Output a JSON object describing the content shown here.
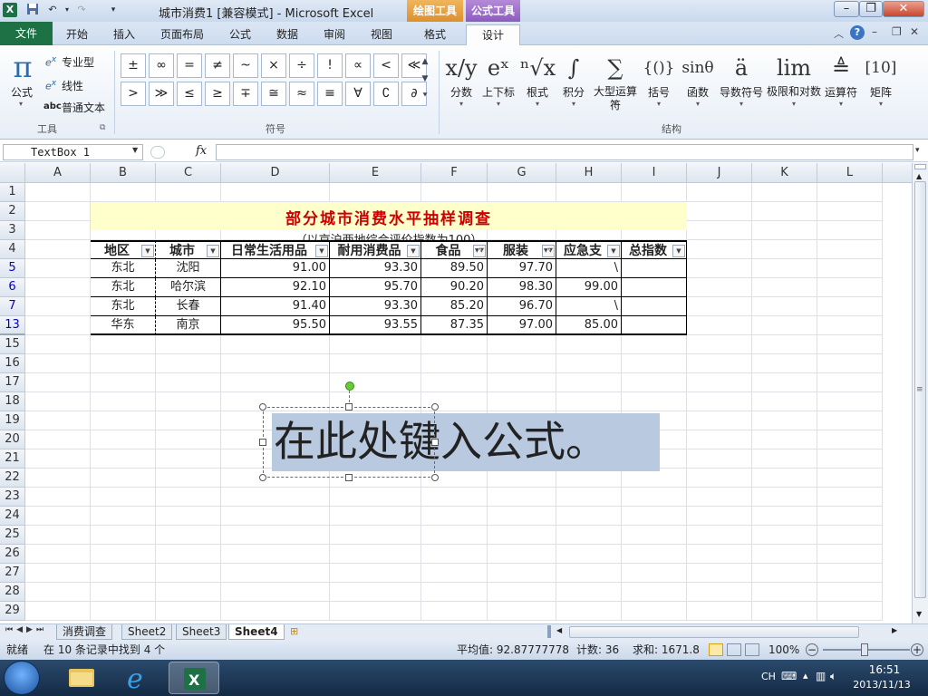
{
  "window": {
    "title": "城市消费1  [兼容模式] - Microsoft Excel",
    "context_tabs": [
      "绘图工具",
      "公式工具"
    ],
    "tabs": [
      "文件",
      "开始",
      "插入",
      "页面布局",
      "公式",
      "数据",
      "审阅",
      "视图",
      "格式",
      "设计"
    ],
    "active_tab": "设计"
  },
  "ribbon": {
    "tools_group": {
      "label": "工具",
      "equation_label": "公式",
      "professional": "专业型",
      "linear": "线性",
      "plain_text": "普通文本",
      "pi_glyph": "π",
      "abc_glyph": "abc"
    },
    "symbols_group": {
      "label": "符号",
      "symbols": [
        "±",
        "∞",
        "=",
        "≠",
        "~",
        "×",
        "÷",
        "!",
        "∝",
        "<",
        "≪",
        ">",
        "≫",
        "≤",
        "≥",
        "∓",
        "≅",
        "≈",
        "≡",
        "∀",
        "∁",
        "∂"
      ]
    },
    "structures_group": {
      "label": "结构",
      "items": [
        {
          "label": "分数",
          "glyph": "x/y"
        },
        {
          "label": "上下标",
          "glyph": "eˣ"
        },
        {
          "label": "根式",
          "glyph": "ⁿ√x"
        },
        {
          "label": "积分",
          "glyph": "∫"
        },
        {
          "label": "大型运算符",
          "glyph": "∑"
        },
        {
          "label": "括号",
          "glyph": "{()}"
        },
        {
          "label": "函数",
          "glyph": "sinθ"
        },
        {
          "label": "导数符号",
          "glyph": "ä"
        },
        {
          "label": "极限和对数",
          "glyph": "lim"
        },
        {
          "label": "运算符",
          "glyph": "≜"
        },
        {
          "label": "矩阵",
          "glyph": "[10]"
        }
      ]
    }
  },
  "formula_bar": {
    "name_box": "TextBox 1",
    "fx": "fx",
    "value": ""
  },
  "sheet": {
    "columns": [
      "A",
      "B",
      "C",
      "D",
      "E",
      "F",
      "G",
      "H",
      "I",
      "J",
      "K",
      "L"
    ],
    "rows": [
      "1",
      "2",
      "3",
      "4",
      "5",
      "6",
      "7",
      "13",
      "15",
      "16",
      "17",
      "18",
      "19",
      "20",
      "21",
      "22",
      "23",
      "24",
      "25",
      "26",
      "27",
      "28",
      "29"
    ],
    "title": "部分城市消费水平抽样调查",
    "subtitle": "（以京沪两地综合评价指数为100）",
    "headers": [
      "地区",
      "城市",
      "日常生活用品",
      "耐用消费品",
      "食品",
      "服装",
      "应急支出",
      "总指数"
    ],
    "header_display": [
      "地区",
      "城市",
      "日常生活用品",
      "耐用消费品",
      "食品",
      "服装",
      "应急支",
      "总指数"
    ],
    "data": [
      [
        "东北",
        "沈阳",
        "91.00",
        "93.30",
        "89.50",
        "97.70",
        "\\",
        ""
      ],
      [
        "东北",
        "哈尔滨",
        "92.10",
        "95.70",
        "90.20",
        "98.30",
        "99.00",
        ""
      ],
      [
        "东北",
        "长春",
        "91.40",
        "93.30",
        "85.20",
        "96.70",
        "\\",
        ""
      ],
      [
        "华东",
        "南京",
        "95.50",
        "93.55",
        "87.35",
        "97.00",
        "85.00",
        ""
      ]
    ]
  },
  "textbox": {
    "text": "在此处键入公式。"
  },
  "sheet_tabs": [
    "消费调查",
    "Sheet2",
    "Sheet3",
    "Sheet4"
  ],
  "active_sheet": "Sheet4",
  "status": {
    "ready": "就绪",
    "filter_info": "在 10 条记录中找到 4 个",
    "average": "平均值: 92.87777778",
    "count": "计数: 36",
    "sum": "求和: 1671.8",
    "zoom": "100%"
  },
  "taskbar": {
    "lang": "CH",
    "time": "16:51",
    "date": "2013/11/13"
  },
  "colors": {
    "file_tab": "#1e7145",
    "drawing_tools": "#e8a24a",
    "equation_tools": "#9b6fc4",
    "title_text": "#cc0000",
    "title_band": "#ffffcc",
    "row_number_filtered": "#0000cc"
  }
}
